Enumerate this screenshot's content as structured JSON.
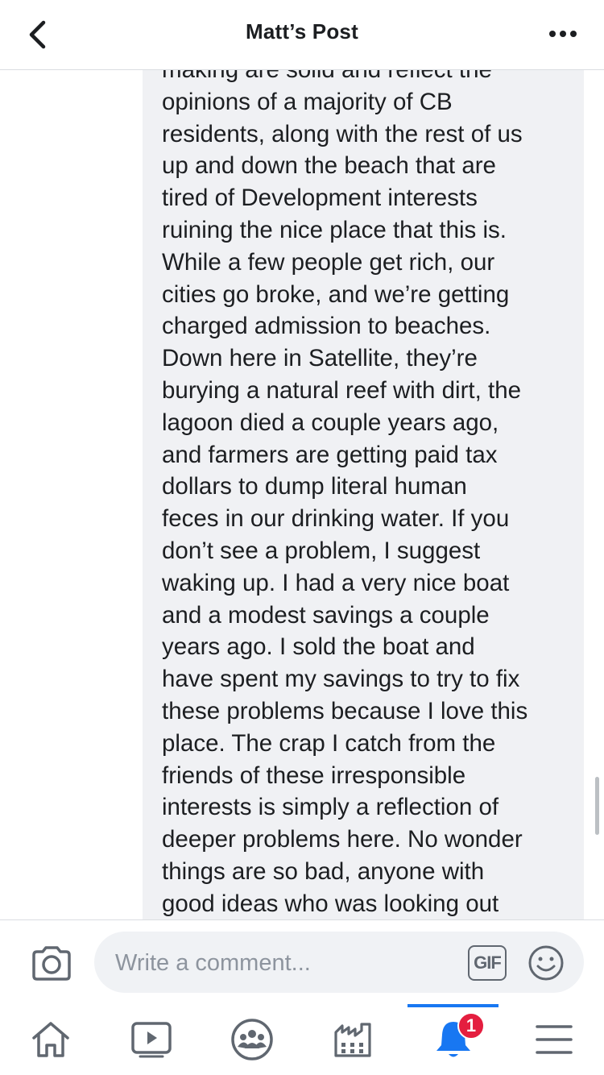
{
  "header": {
    "title": "Matt’s Post",
    "back_icon": "chevron-left-icon",
    "more_icon": "more-horizontal-icon"
  },
  "comment": {
    "text_lines": [
      "making are solid and reflect the",
      "opinions of a majority of CB",
      "residents, along with the rest of us",
      "up and down the beach that are",
      "tired of Development interests",
      "ruining the nice place that this is.",
      "While a few people get rich, our",
      "cities go broke, and we’re getting",
      "charged admission to beaches.",
      "Down here in Satellite, they’re",
      "burying a natural reef with dirt, the",
      "lagoon died a couple years ago,",
      "and farmers are getting paid tax",
      "dollars to dump literal human",
      "feces in our drinking water. If you",
      "don’t see a problem, I suggest",
      "waking up. I had a very nice boat",
      "and a modest savings a couple",
      "years ago. I sold the boat and",
      "have spent my savings to try to fix",
      "these problems because I love this",
      "place. The crap I catch from the",
      "friends of these irresponsible",
      "interests is simply a reflection of",
      "deeper problems here. No wonder",
      "things are so bad, anyone with",
      "good ideas who was looking out"
    ]
  },
  "comment_bar": {
    "placeholder": "Write a comment...",
    "gif_label": "GIF",
    "camera_icon": "camera-icon",
    "emoji_icon": "emoji-icon"
  },
  "tabbar": {
    "tabs": [
      {
        "icon": "home-icon"
      },
      {
        "icon": "video-icon"
      },
      {
        "icon": "groups-icon"
      },
      {
        "icon": "marketplace-icon"
      },
      {
        "icon": "notifications-icon",
        "active": true,
        "badge": "1"
      },
      {
        "icon": "menu-icon"
      }
    ],
    "notification_badge": "1"
  },
  "colors": {
    "accent": "#1877f2",
    "badge": "#e41e3f",
    "bubble": "#f0f1f4",
    "icon": "#606770"
  }
}
